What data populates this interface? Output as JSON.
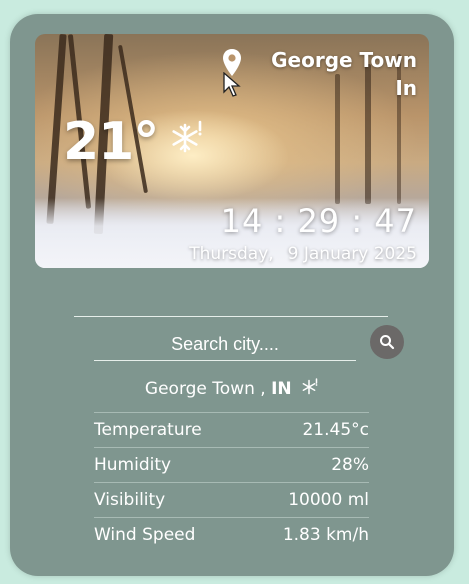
{
  "location": {
    "city": "George Town",
    "country": "In"
  },
  "weather": {
    "temperature": "21°",
    "condition_icon": "snowflake-icon"
  },
  "clock": {
    "time": "14 : 29 : 47",
    "weekday": "Thursday,",
    "date": "9 January 2025"
  },
  "search": {
    "placeholder": "Search city...."
  },
  "info": {
    "city": "George Town ,",
    "country_code": "IN",
    "rows": [
      {
        "label": "Temperature",
        "value": "21.45°c"
      },
      {
        "label": "Humidity",
        "value": "28%"
      },
      {
        "label": "Visibility",
        "value": "10000 ml"
      },
      {
        "label": "Wind Speed",
        "value": "1.83 km/h"
      }
    ]
  },
  "colors": {
    "page_bg": "#c9ebdf",
    "card_bg": "#7f968f",
    "search_button": "#6b6968",
    "text": "#ffffff"
  }
}
